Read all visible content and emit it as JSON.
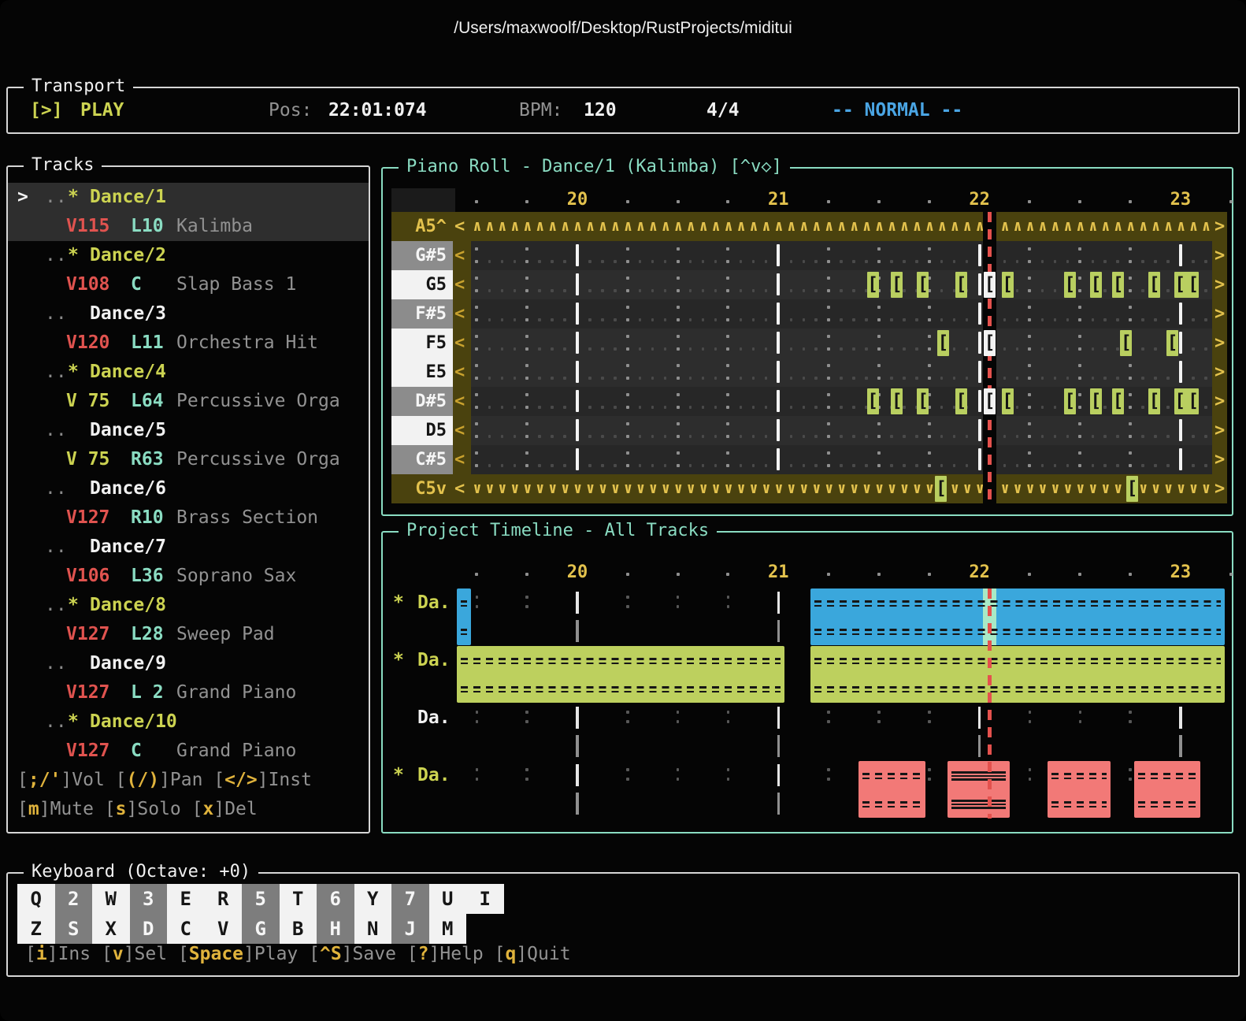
{
  "window": {
    "title": "/Users/maxwoolf/Desktop/RustProjects/miditui"
  },
  "transport": {
    "title": "Transport",
    "play_icon": "[>]",
    "play_label": "PLAY",
    "pos_label": "Pos:",
    "pos_value": "22:01:074",
    "bpm_label": "BPM:",
    "bpm_value": "120",
    "time_signature": "4/4",
    "mode_text": "-- NORMAL --"
  },
  "tracks": {
    "title": "Tracks",
    "cursor": ">",
    "dots": "..",
    "star": "*",
    "items": [
      {
        "name": "Dance/1",
        "starred": true,
        "selected": true,
        "vol": "V115",
        "vol_level": "high",
        "pan": "L10",
        "instrument": "Kalimba"
      },
      {
        "name": "Dance/2",
        "starred": true,
        "selected": false,
        "vol": "V108",
        "vol_level": "high",
        "pan": "C",
        "instrument": "Slap Bass 1"
      },
      {
        "name": "Dance/3",
        "starred": false,
        "selected": false,
        "vol": "V120",
        "vol_level": "high",
        "pan": "L11",
        "instrument": "Orchestra Hit"
      },
      {
        "name": "Dance/4",
        "starred": true,
        "selected": false,
        "vol": "V 75",
        "vol_level": "mid",
        "pan": "L64",
        "instrument": "Percussive Orga"
      },
      {
        "name": "Dance/5",
        "starred": false,
        "selected": false,
        "vol": "V 75",
        "vol_level": "mid",
        "pan": "R63",
        "instrument": "Percussive Orga"
      },
      {
        "name": "Dance/6",
        "starred": false,
        "selected": false,
        "vol": "V127",
        "vol_level": "high",
        "pan": "R10",
        "instrument": "Brass Section"
      },
      {
        "name": "Dance/7",
        "starred": false,
        "selected": false,
        "vol": "V106",
        "vol_level": "high",
        "pan": "L36",
        "instrument": "Soprano Sax"
      },
      {
        "name": "Dance/8",
        "starred": true,
        "selected": false,
        "vol": "V127",
        "vol_level": "high",
        "pan": "L28",
        "instrument": "Sweep Pad"
      },
      {
        "name": "Dance/9",
        "starred": false,
        "selected": false,
        "vol": "V127",
        "vol_level": "high",
        "pan": "L 2",
        "instrument": "Grand Piano"
      },
      {
        "name": "Dance/10",
        "starred": true,
        "selected": false,
        "vol": "V127",
        "vol_level": "high",
        "pan": "C",
        "instrument": "Grand Piano"
      }
    ],
    "hint_lines": [
      [
        {
          "t": "[",
          "k": 0
        },
        {
          "t": ";/'",
          "k": 1
        },
        {
          "t": "]Vol ",
          "k": 0
        },
        {
          "t": "[",
          "k": 0
        },
        {
          "t": "(/)",
          "k": 1
        },
        {
          "t": "]Pan ",
          "k": 0
        },
        {
          "t": "[",
          "k": 0
        },
        {
          "t": "</>",
          "k": 1
        },
        {
          "t": "]Inst",
          "k": 0
        }
      ],
      [
        {
          "t": "[",
          "k": 0
        },
        {
          "t": "m",
          "k": 1
        },
        {
          "t": "]Mute ",
          "k": 0
        },
        {
          "t": "[",
          "k": 0
        },
        {
          "t": "s",
          "k": 1
        },
        {
          "t": "]Solo ",
          "k": 0
        },
        {
          "t": "[",
          "k": 0
        },
        {
          "t": "x",
          "k": 1
        },
        {
          "t": "]Del",
          "k": 0
        }
      ]
    ]
  },
  "piano_roll": {
    "title": "Piano Roll - Dance/1 (Kalimba) [^v◇]",
    "ruler_measures": [
      20,
      21,
      22,
      23
    ],
    "playhead_measure": 22.05,
    "scroll_left_glyph": "<",
    "scroll_right_glyph": ">",
    "note_glyph": "[",
    "rows": [
      {
        "label": "A5^",
        "kind": "fold_up",
        "notes": []
      },
      {
        "label": "G#5",
        "kind": "sharp",
        "notes": []
      },
      {
        "label": "G5",
        "kind": "natural",
        "notes": [
          {
            "m": 21.44
          },
          {
            "m": 21.56
          },
          {
            "m": 21.69
          },
          {
            "m": 21.88
          },
          {
            "m": 22.05,
            "playing": true
          },
          {
            "m": 22.11
          },
          {
            "m": 22.42
          },
          {
            "m": 22.55
          },
          {
            "m": 22.66
          },
          {
            "m": 22.84
          },
          {
            "m": 22.97,
            "len": 2
          }
        ]
      },
      {
        "label": "F#5",
        "kind": "sharp",
        "notes": []
      },
      {
        "label": "F5",
        "kind": "natural",
        "notes": [
          {
            "m": 21.79
          },
          {
            "m": 22.05,
            "playing": true
          },
          {
            "m": 22.7
          },
          {
            "m": 22.93
          }
        ]
      },
      {
        "label": "E5",
        "kind": "natural",
        "notes": []
      },
      {
        "label": "D#5",
        "kind": "sharp",
        "notes": [
          {
            "m": 21.44
          },
          {
            "m": 21.56
          },
          {
            "m": 21.69
          },
          {
            "m": 21.88
          },
          {
            "m": 22.05,
            "playing": true
          },
          {
            "m": 22.11
          },
          {
            "m": 22.42
          },
          {
            "m": 22.55
          },
          {
            "m": 22.66
          },
          {
            "m": 22.84
          },
          {
            "m": 22.97,
            "len": 2
          }
        ]
      },
      {
        "label": "D5",
        "kind": "natural",
        "notes": []
      },
      {
        "label": "C#5",
        "kind": "sharp",
        "notes": []
      },
      {
        "label": "C5v",
        "kind": "fold_down",
        "notes": [
          {
            "m": 21.78
          },
          {
            "m": 22.73
          }
        ]
      }
    ]
  },
  "timeline": {
    "title": "Project Timeline - All Tracks",
    "ruler_measures": [
      20,
      21,
      22,
      23
    ],
    "playhead_measure": 22.05,
    "rows": [
      {
        "label": "Da.",
        "starred": true,
        "clips": [
          {
            "color": "blue",
            "start": 19.4,
            "end": 19.47
          },
          {
            "color": "blue",
            "start": 21.16,
            "end": 23.22,
            "playhead_highlight": true
          }
        ]
      },
      {
        "label": "Da.",
        "starred": true,
        "clips": [
          {
            "color": "olive",
            "start": 19.4,
            "end": 21.03
          },
          {
            "color": "olive",
            "start": 21.16,
            "end": 23.22
          }
        ]
      },
      {
        "label": "Da.",
        "starred": false,
        "clips": []
      },
      {
        "label": "Da.",
        "starred": true,
        "clips": [
          {
            "color": "red",
            "start": 21.4,
            "end": 21.73
          },
          {
            "color": "red",
            "start": 21.84,
            "end": 22.15,
            "dense": true
          },
          {
            "color": "red",
            "start": 22.34,
            "end": 22.65
          },
          {
            "color": "red",
            "start": 22.77,
            "end": 23.1
          }
        ]
      }
    ]
  },
  "keyboard": {
    "title": "Keyboard (Octave: +0)",
    "top_row": [
      {
        "key": "Q",
        "type": "white"
      },
      {
        "key": "2",
        "type": "black"
      },
      {
        "key": "W",
        "type": "white"
      },
      {
        "key": "3",
        "type": "black"
      },
      {
        "key": "E",
        "type": "white"
      },
      {
        "key": "R",
        "type": "white"
      },
      {
        "key": "5",
        "type": "black"
      },
      {
        "key": "T",
        "type": "white"
      },
      {
        "key": "6",
        "type": "black"
      },
      {
        "key": "Y",
        "type": "white"
      },
      {
        "key": "7",
        "type": "black"
      },
      {
        "key": "U",
        "type": "white"
      },
      {
        "key": "I",
        "type": "white"
      }
    ],
    "bottom_row": [
      {
        "key": "Z",
        "type": "white"
      },
      {
        "key": "S",
        "type": "black"
      },
      {
        "key": "X",
        "type": "white"
      },
      {
        "key": "D",
        "type": "black"
      },
      {
        "key": "C",
        "type": "white"
      },
      {
        "key": "V",
        "type": "white"
      },
      {
        "key": "G",
        "type": "black"
      },
      {
        "key": "B",
        "type": "white"
      },
      {
        "key": "H",
        "type": "black"
      },
      {
        "key": "N",
        "type": "white"
      },
      {
        "key": "J",
        "type": "black"
      },
      {
        "key": "M",
        "type": "white"
      }
    ],
    "hints": [
      [
        {
          "t": "[",
          "k": 0
        },
        {
          "t": "i",
          "k": 1
        },
        {
          "t": "]Ins ",
          "k": 0
        },
        {
          "t": "[",
          "k": 0
        },
        {
          "t": "v",
          "k": 1
        },
        {
          "t": "]Sel ",
          "k": 0
        },
        {
          "t": "[",
          "k": 0
        },
        {
          "t": "Space",
          "k": 1
        },
        {
          "t": "]Play ",
          "k": 0
        },
        {
          "t": "[",
          "k": 0
        },
        {
          "t": "^S",
          "k": 1
        },
        {
          "t": "]Save ",
          "k": 0
        },
        {
          "t": "[",
          "k": 0
        },
        {
          "t": "?",
          "k": 1
        },
        {
          "t": "]Help ",
          "k": 0
        },
        {
          "t": "[",
          "k": 0
        },
        {
          "t": "q",
          "k": 1
        },
        {
          "t": "]Quit",
          "k": 0
        }
      ]
    ]
  },
  "colors": {
    "accent": "#ccd351",
    "yellow": "#e3c24d",
    "gold": "#c9a22e",
    "olive_bg": "#4a420e",
    "note_green": "#b9cf60",
    "clip_blue": "#3aa7dc",
    "clip_olive": "#bdd05e",
    "clip_red": "#f27977",
    "playhead_red": "#e4514d",
    "mint": "#a9e9c6",
    "vol_red": "#e0534f",
    "pan_teal": "#8adcc2",
    "text_gray": "#929292",
    "text_white": "#f1f1f1",
    "key_yellow": "#e0b33c",
    "mode_blue": "#4aa5e4",
    "sharp_row": "#272727",
    "natural_row": "#2d2d2d",
    "sharp_label_bg": "#8c8c8c",
    "natural_label_bg": "#f2f2f2",
    "selected_bg": "#2e2e2e",
    "dot_dim": "#4a4a4a",
    "dot_bright": "#8f8f8f",
    "bar_white": "#f3f3f3",
    "bar_gray": "#909090",
    "tl_dot": "#585858"
  }
}
